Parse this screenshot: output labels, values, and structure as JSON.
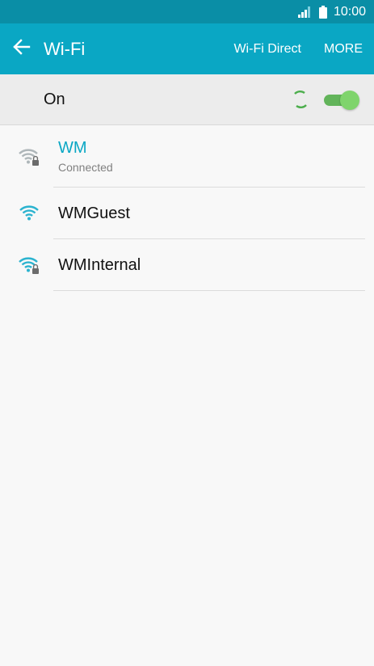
{
  "status_bar": {
    "time": "10:00",
    "icons": [
      "signal-icon",
      "battery-icon"
    ]
  },
  "app_bar": {
    "title": "Wi-Fi",
    "actions": [
      "Wi-Fi Direct",
      "MORE"
    ],
    "back_icon": "arrow-left-icon"
  },
  "master": {
    "label": "On",
    "toggle_on": true
  },
  "networks": [
    {
      "name": "WM",
      "status": "Connected",
      "secured": true,
      "connected": true
    },
    {
      "name": "WMGuest",
      "status": "",
      "secured": false,
      "connected": false
    },
    {
      "name": "WMInternal",
      "status": "",
      "secured": true,
      "connected": false
    }
  ],
  "colors": {
    "status_bar": "#0a8ea6",
    "app_bar": "#0aa7c4",
    "accent": "#0aa7c4",
    "toggle": "#62b45a",
    "wifi_icon": "#2bb3cf"
  }
}
